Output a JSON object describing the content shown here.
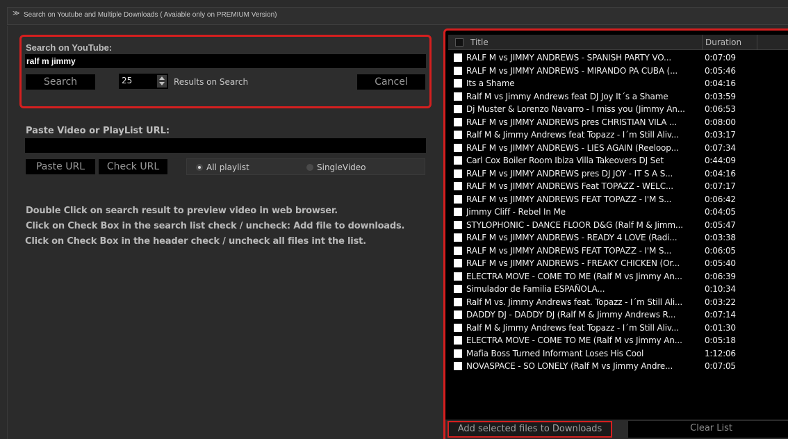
{
  "header": {
    "text": "Search on Youtube and Multiple Downloads ( Avaiable only on PREMIUM Version)"
  },
  "search": {
    "label": "Search on YouTube:",
    "value": "ralf m jimmy",
    "search_button": "Search",
    "results_count": "25",
    "results_label": "Results on Search",
    "cancel_button": "Cancel"
  },
  "url": {
    "label": "Paste Video or PlayList URL:",
    "value": "",
    "paste_button": "Paste URL",
    "check_button": "Check URL",
    "radio_all": "All playlist",
    "radio_single": "SingleVideo",
    "selected": "All playlist"
  },
  "help": {
    "line1": "Double Click on search result to preview video in web browser.",
    "line2": "Click on Check Box in the search list check / uncheck: Add file to downloads.",
    "line3": "Click on Check Box in the header check / uncheck all files int the list."
  },
  "list": {
    "columns": {
      "title": "Title",
      "duration": "Duration"
    },
    "rows": [
      {
        "title": "RALF M vs JIMMY ANDREWS - SPANISH PARTY VO...",
        "duration": "0:07:09"
      },
      {
        "title": "RALF M vs JIMMY ANDREWS - MIRANDO PA CUBA (...",
        "duration": "0:05:46"
      },
      {
        "title": "Its a Shame",
        "duration": "0:04:16"
      },
      {
        "title": "Ralf M vs Jimmy Andrews feat DJ Joy   It´s a Shame",
        "duration": "0:03:59"
      },
      {
        "title": "Dj Muster & Lorenzo Navarro - I miss you (Jimmy An...",
        "duration": "0:06:53"
      },
      {
        "title": "RALF M vs JIMMY ANDREWS pres CHRISTIAN VILA ...",
        "duration": "0:08:00"
      },
      {
        "title": "Ralf M & Jimmy Andrews feat Topazz - I´m Still Aliv...",
        "duration": "0:03:17"
      },
      {
        "title": "RALF M vs JIMMY ANDREWS - LIES AGAIN (Reeloop...",
        "duration": "0:07:34"
      },
      {
        "title": "Carl Cox Boiler Room Ibiza Villa Takeovers DJ Set",
        "duration": "0:44:09"
      },
      {
        "title": "RALF M vs JIMMY ANDREWS pres DJ JOY - IT S A S...",
        "duration": "0:04:16"
      },
      {
        "title": "RALF M vs JIMMY ANDREWS Feat TOPAZZ - WELC...",
        "duration": "0:07:17"
      },
      {
        "title": "RALF M vs JIMMY ANDREWS FEAT TOPAZZ - I'M S...",
        "duration": "0:06:42"
      },
      {
        "title": "Jimmy Cliff - Rebel In Me",
        "duration": "0:04:05"
      },
      {
        "title": "STYLOPHONIC - DANCE FLOOR D&G (Ralf M & Jimm...",
        "duration": "0:05:47"
      },
      {
        "title": "RALF M vs JIMMY ANDREWS - READY 4 LOVE (Radi...",
        "duration": "0:03:38"
      },
      {
        "title": "RALF M vs JIMMY ANDREWS FEAT TOPAZZ - I'M S...",
        "duration": "0:06:05"
      },
      {
        "title": "RALF M vs JIMMY ANDREWS - FREAKY CHICKEN (Or...",
        "duration": "0:05:40"
      },
      {
        "title": "ELECTRA MOVE - COME TO ME (Ralf M vs Jimmy An...",
        "duration": "0:06:39"
      },
      {
        "title": "Simulador de Familia ESPAÑOLA...",
        "duration": "0:10:34"
      },
      {
        "title": "Ralf M vs. Jimmy Andrews feat. Topazz - I´m Still Ali...",
        "duration": "0:03:22"
      },
      {
        "title": "DADDY DJ - DADDY DJ (Ralf M & Jimmy Andrews R...",
        "duration": "0:07:14"
      },
      {
        "title": "Ralf M & Jimmy Andrews feat Topazz - I´m Still Aliv...",
        "duration": "0:01:30"
      },
      {
        "title": "ELECTRA MOVE - COME TO ME (Ralf M vs Jimmy An...",
        "duration": "0:05:18"
      },
      {
        "title": "Mafia Boss Turned Informant Loses His Cool",
        "duration": "1:12:06"
      },
      {
        "title": "NOVASPACE - SO LONELY (Ralf M vs Jimmy Andre...",
        "duration": "0:07:05"
      }
    ]
  },
  "footer": {
    "add_button": "Add selected files to Downloads",
    "clear_button": "Clear List"
  },
  "colors": {
    "highlight": "#d51f1f",
    "background": "#2b2b2b",
    "field": "#000000"
  }
}
